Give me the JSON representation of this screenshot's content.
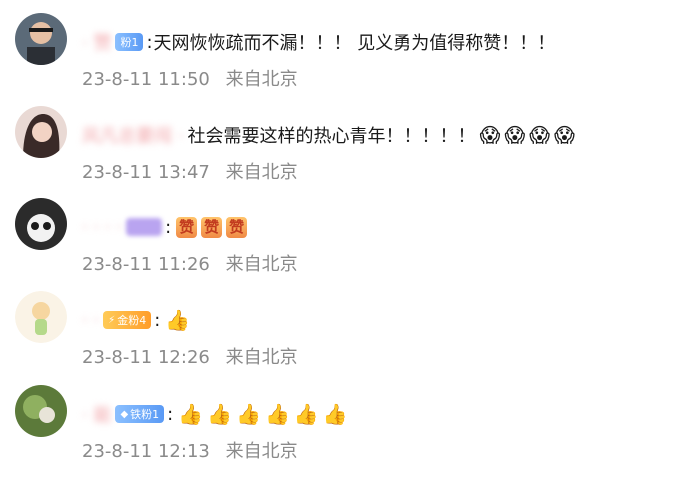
{
  "comments": [
    {
      "name": "·    赞 ",
      "badge": {
        "text": "粉1",
        "style": "blue",
        "icon": ""
      },
      "text": "天网恢恢疏而不漏！！！ 见义勇为值得称赞！！！",
      "emojis": [],
      "date": "23-8-11 11:50",
      "location": "来自北京"
    },
    {
      "name": "风凡总要闯  ·",
      "badge": null,
      "text": "社会需要这样的热心青年！！！！！",
      "emojis": [
        "😱",
        "😱",
        "😱",
        "😱"
      ],
      "date": "23-8-11 13:47",
      "location": "来自北京"
    },
    {
      "name": "·  · ·   ·  ",
      "badge": {
        "text": " ",
        "style": "purple",
        "icon": ""
      },
      "text": "",
      "emojis": [
        "赞",
        "赞",
        "赞"
      ],
      "date": "23-8-11 11:26",
      "location": "来自北京"
    },
    {
      "name": "  ·  ·  ",
      "badge": {
        "text": "金粉4",
        "style": "gold",
        "icon": "⚡"
      },
      "text": "",
      "emojis": [
        "👍"
      ],
      "date": "23-8-11 12:26",
      "location": "来自北京"
    },
    {
      "name": "  · 能",
      "badge": {
        "text": "铁粉1",
        "style": "blue",
        "icon": "◆"
      },
      "text": "",
      "emojis": [
        "👍",
        "👍",
        "👍",
        "👍",
        "👍",
        "👍"
      ],
      "date": "23-8-11 12:13",
      "location": "来自北京"
    }
  ]
}
